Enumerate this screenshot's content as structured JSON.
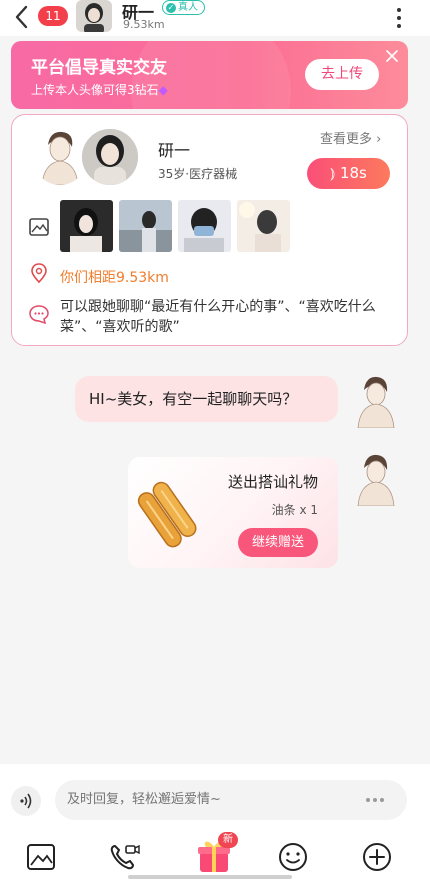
{
  "header": {
    "unread_count": "11",
    "name": "研一",
    "verified_label": "真人",
    "distance": "9.53km"
  },
  "banner": {
    "title": "平台倡导真实交友",
    "subtitle": "上传本人头像可得3钻石",
    "button": "去上传"
  },
  "profile": {
    "name": "研一",
    "info": "35岁·医疗器械",
    "see_more": "查看更多",
    "voice_duration": "18s",
    "distance_text": "你们相距9.53km",
    "tips": "可以跟她聊聊“最近有什么开心的事”、“喜欢吃什么菜”、“喜欢听的歌”"
  },
  "chat": {
    "greeting": "HI~美女，有空一起聊聊天吗？",
    "gift": {
      "title": "送出搭讪礼物",
      "item": "油条 x 1",
      "button": "继续赠送"
    }
  },
  "input": {
    "placeholder": "及时回复，轻松邂逅爱情~"
  },
  "toolbar": {
    "new_badge": "新"
  },
  "colors": {
    "accent_pink": "#f8567a",
    "banner_gradient_start": "#f86aa5",
    "distance_orange": "#f07d2c",
    "verified_teal": "#2cbfae",
    "unread_red": "#f33f4a"
  },
  "icons": [
    "back-icon",
    "more-icon",
    "close-icon",
    "voice-wave-icon",
    "photo-icon",
    "location-icon",
    "chat-bubble-icon",
    "gift-icon",
    "video-call-icon",
    "emoji-icon",
    "plus-icon"
  ]
}
